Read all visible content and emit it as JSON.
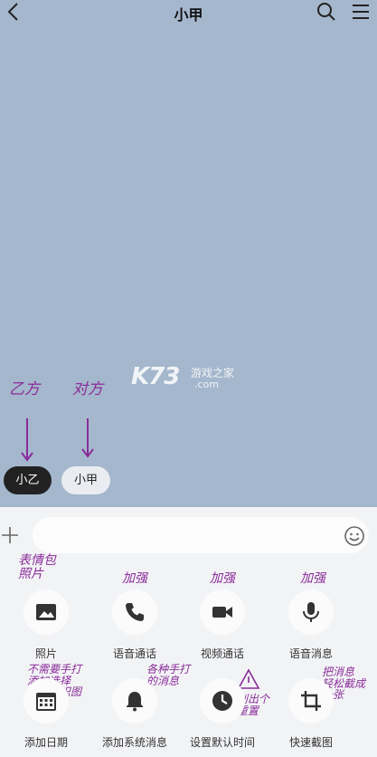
{
  "header": {
    "title": "小甲"
  },
  "roles": {
    "a": "小乙",
    "b": "小甲"
  },
  "watermark": {
    "brand": "K73",
    "cn": "游戏之家",
    "domain": ".com"
  },
  "composer": {
    "placeholder": "",
    "value": ""
  },
  "actions": [
    {
      "label": "照片",
      "icon": "image-icon"
    },
    {
      "label": "语音通话",
      "icon": "phone-icon"
    },
    {
      "label": "视频通话",
      "icon": "video-camera-icon"
    },
    {
      "label": "语音消息",
      "icon": "microphone-icon"
    },
    {
      "label": "添加日期",
      "icon": "calendar-icon"
    },
    {
      "label": "添加系统消息",
      "icon": "bell-icon"
    },
    {
      "label": "设置默认时间",
      "icon": "clock-icon"
    },
    {
      "label": "快速截图",
      "icon": "crop-icon"
    }
  ],
  "annotations": {
    "role_a": "乙方",
    "role_b": "对方",
    "photo": "表情包\n照片",
    "voice_call": "加强",
    "video_call": "加强",
    "voice_msg": "加强",
    "date": "不需要手打\n添加选择\n日期给识图",
    "system": "各种手打\n的消息",
    "time": "别出个\n重置",
    "screenshot": "把消息\n轻松截成\n一张"
  },
  "colors": {
    "chat_bg": "#a5b7cd",
    "panel_bg": "#f2f3f5",
    "annotation": "#8a2c9a",
    "role_a_bg": "#222222",
    "role_b_bg": "#e9edf2"
  }
}
